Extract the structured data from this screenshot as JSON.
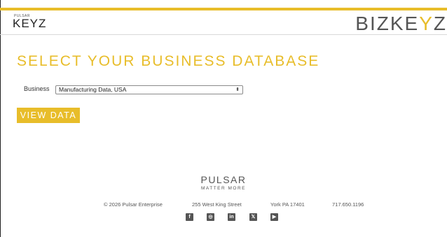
{
  "header": {
    "brand_left_small": "PULSAR",
    "brand_left_big": "KEYZ",
    "brand_right_pre": "BIZKE",
    "brand_right_y": "Y",
    "brand_right_post": "Z"
  },
  "main": {
    "title": "SELECT YOUR BUSINESS DATABASE",
    "business_label": "Business",
    "business_selected": "Manufacturing Data, USA",
    "view_button": "VIEW DATA"
  },
  "footer": {
    "logo": "PULSAR",
    "tagline": "MATTER MORE",
    "copyright": "© 2026 Pulsar Enterprise",
    "street": "255 West King Street",
    "city": "York PA 17401",
    "phone": "717.650.1196",
    "social_icons": [
      "facebook-icon",
      "instagram-icon",
      "linkedin-icon",
      "x-icon",
      "youtube-icon"
    ]
  },
  "colors": {
    "accent": "#e8bd2a",
    "text": "#333333"
  }
}
